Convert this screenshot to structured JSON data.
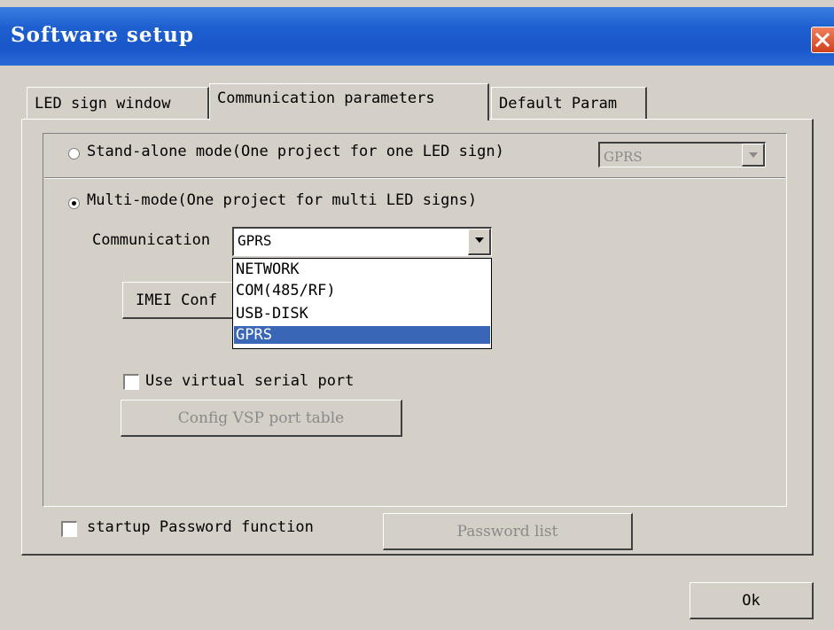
{
  "window": {
    "title": "Software setup",
    "close_glyph": "close-icon"
  },
  "tabs": [
    {
      "label": "LED sign window",
      "active": false
    },
    {
      "label": "Communication parameters",
      "active": true
    },
    {
      "label": "Default Param",
      "active": false
    }
  ],
  "comm": {
    "standalone_label": "Stand-alone mode(One project for one LED sign)",
    "standalone_checked": false,
    "standalone_combo_value": "GPRS",
    "multimode_label": "Multi-mode(One project for multi LED signs)",
    "multimode_checked": true,
    "communication_label": "Communication",
    "communication_value": "GPRS",
    "communication_options": [
      "NETWORK",
      "COM(485/RF)",
      "USB-DISK",
      "GPRS"
    ],
    "communication_selected_index": 3,
    "imei_button_label": "IMEI Conf",
    "virtual_serial_label": "Use virtual serial port",
    "virtual_serial_checked": false,
    "vsp_button_label": "Config VSP port table"
  },
  "footer": {
    "password_label": "startup Password function",
    "password_checked": false,
    "password_list_label": "Password list",
    "ok_label": "Ok"
  },
  "colors": {
    "title_bar": "#1e5fd0",
    "face": "#d4d0c8",
    "selection": "#3a66b8",
    "close_button": "#d0401c"
  }
}
